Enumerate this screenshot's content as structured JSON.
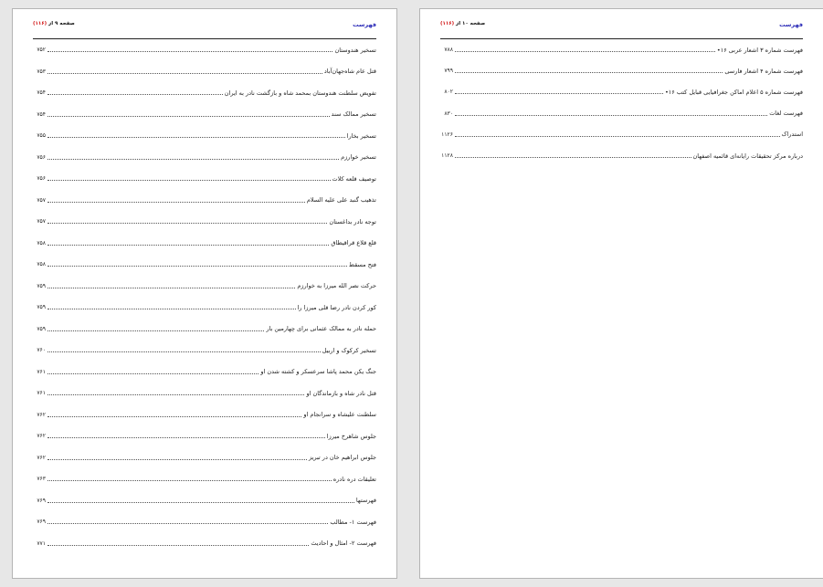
{
  "left_page": {
    "header": {
      "title": "فهرست",
      "page_label": "صفحه ۹ از",
      "page_total": "(۱۱۶)"
    },
    "entries": [
      {
        "title": "تسخیر هندوستان",
        "page": "۷۵۲"
      },
      {
        "title": "قتل عام شاه‌جهان‌آباد",
        "page": "۷۵۳"
      },
      {
        "title": "تفویض سلطنت هندوستان بمحمد شاه و بازگشت نادر به ایران",
        "page": "۷۵۴"
      },
      {
        "title": "تسخیر ممالک سند",
        "page": "۷۵۴"
      },
      {
        "title": "تسخیر بخارا",
        "page": "۷۵۵"
      },
      {
        "title": "تسخیر خوارزم",
        "page": "۷۵۶"
      },
      {
        "title": "توصیف قلعه کلات",
        "page": "۷۵۶"
      },
      {
        "title": "تذهیب گنبد علی علیه السلام",
        "page": "۷۵۷"
      },
      {
        "title": "توجه نادر بداغستان",
        "page": "۷۵۷"
      },
      {
        "title": "قلع قلاع قراقیطاق",
        "page": "۷۵۸"
      },
      {
        "title": "فتح مسقط",
        "page": "۷۵۸"
      },
      {
        "title": "حرکت نصر الله میرزا به خوارزم",
        "page": "۷۵۹"
      },
      {
        "title": "کور کردن نادر رضا قلی میرزا را",
        "page": "۷۵۹"
      },
      {
        "title": "حمله نادر به ممالک عثمانی برای چهارمین بار",
        "page": "۷۵۹"
      },
      {
        "title": "تسخیر کرکوک و اربیل",
        "page": "۷۶۰"
      },
      {
        "title": "جنگ یکن محمد پاشا سرعسکر و کشته شدن او",
        "page": "۷۶۱"
      },
      {
        "title": "قتل نادر شاه و بازماندگان او",
        "page": "۷۶۱"
      },
      {
        "title": "سلطنت علیشاه و سرانجام او",
        "page": "۷۶۲"
      },
      {
        "title": "جلوس شاهرخ میرزا",
        "page": "۷۶۲"
      },
      {
        "title": "جلوس ابراهیم خان در تبریز",
        "page": "۷۶۲"
      },
      {
        "title": "تعلیقات دره نادره",
        "page": "۷۶۳"
      },
      {
        "title": "فهرستها",
        "page": "۷۶۹"
      },
      {
        "title": "فهرست ۱- مطالب",
        "page": "۷۶۹"
      },
      {
        "title": "فهرست ۲- امثال و احادیث",
        "page": "۷۷۱"
      }
    ]
  },
  "right_page": {
    "header": {
      "title": "فهرست",
      "page_label": "صفحه ۱۰ از",
      "page_total": "(۱۱۶)"
    },
    "entries": [
      {
        "title": "فهرست شماره ۳ اشعار عربی ۱۶•",
        "page": "۷۸۸"
      },
      {
        "title": "فهرست شماره ۴ اشعار فارسی",
        "page": "۷۹۹"
      },
      {
        "title": "فهرست شماره ۵ اعلام اماکن جغرافیایی قبایل کتب ۱۶•",
        "page": "۸۰۲"
      },
      {
        "title": "فهرست لغات",
        "page": "۸۳۰"
      },
      {
        "title": "استدراک",
        "page": "۱۱۲۶"
      },
      {
        "title": "درباره مرکز تحقیقات رایانه‌ای قائمیه اصفهان",
        "page": "۱۱۲۸"
      }
    ]
  },
  "colors": {
    "header_title": "#2d2db8",
    "header_total": "#d01010",
    "background": "#e7e7e7"
  }
}
